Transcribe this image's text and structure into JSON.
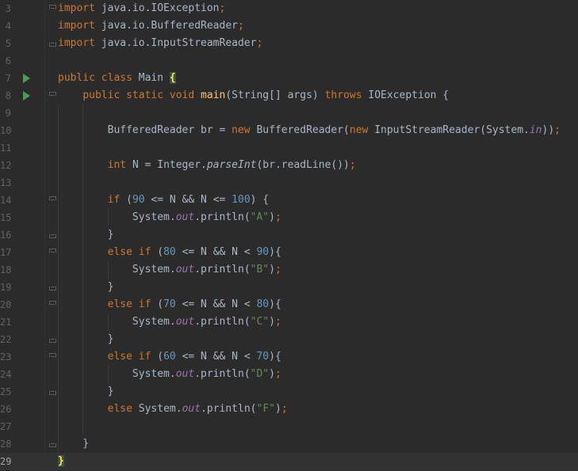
{
  "editor": {
    "language": "Java",
    "current_line": "29",
    "colors": {
      "background": "#2b2b2b",
      "keyword": "#cc7832",
      "text": "#a9b7c6",
      "method_decl": "#ffc66d",
      "number": "#6897bb",
      "string": "#6a8759",
      "static_field": "#9876aa",
      "line_number": "#606366",
      "run_gutter_icon": "#499c54"
    },
    "lines": [
      {
        "num": "3",
        "text": "import java.io.IOException;"
      },
      {
        "num": "4",
        "text": "import java.io.BufferedReader;"
      },
      {
        "num": "5",
        "text": "import java.io.InputStreamReader;"
      },
      {
        "num": "6",
        "text": ""
      },
      {
        "num": "7",
        "text": "public class Main {",
        "gutter_icon": "run-icon"
      },
      {
        "num": "8",
        "text": "    public static void main(String[] args) throws IOException {",
        "gutter_icon": "run-icon"
      },
      {
        "num": "9",
        "text": ""
      },
      {
        "num": "10",
        "text": "        BufferedReader br = new BufferedReader(new InputStreamReader(System.in));"
      },
      {
        "num": "11",
        "text": ""
      },
      {
        "num": "12",
        "text": "        int N = Integer.parseInt(br.readLine());"
      },
      {
        "num": "13",
        "text": ""
      },
      {
        "num": "14",
        "text": "        if (90 <= N && N <= 100) {"
      },
      {
        "num": "15",
        "text": "            System.out.println(\"A\");"
      },
      {
        "num": "16",
        "text": "        }"
      },
      {
        "num": "17",
        "text": "        else if (80 <= N && N < 90){"
      },
      {
        "num": "18",
        "text": "            System.out.println(\"B\");"
      },
      {
        "num": "19",
        "text": "        }"
      },
      {
        "num": "20",
        "text": "        else if (70 <= N && N < 80){"
      },
      {
        "num": "21",
        "text": "            System.out.println(\"C\");"
      },
      {
        "num": "22",
        "text": "        }"
      },
      {
        "num": "23",
        "text": "        else if (60 <= N && N < 70){"
      },
      {
        "num": "24",
        "text": "            System.out.println(\"D\");"
      },
      {
        "num": "25",
        "text": "        }"
      },
      {
        "num": "26",
        "text": "        else System.out.println(\"F\");"
      },
      {
        "num": "27",
        "text": ""
      },
      {
        "num": "28",
        "text": "    }"
      },
      {
        "num": "29",
        "text": "}"
      }
    ]
  }
}
